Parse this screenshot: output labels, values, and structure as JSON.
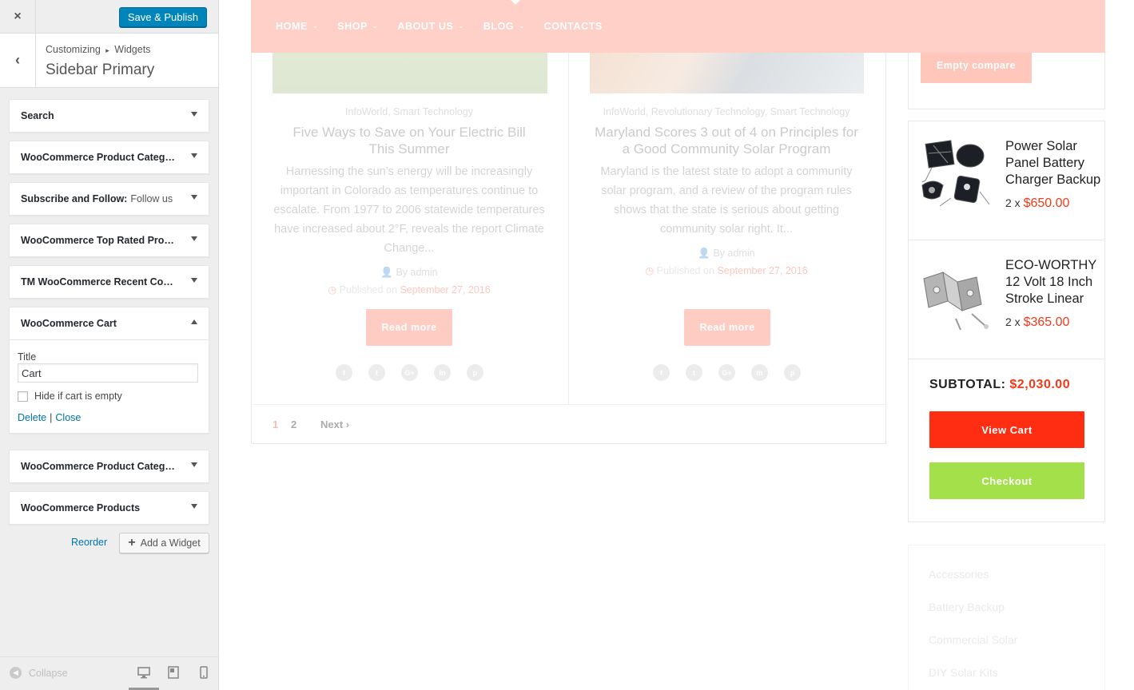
{
  "customizer": {
    "close_label": "×",
    "publish_label": "Save & Publish",
    "back_label": "‹",
    "breadcrumb": {
      "root": "Customizing",
      "sep": "▸",
      "leaf": "Widgets"
    },
    "section_title": "Sidebar Primary",
    "widgets": [
      {
        "name": "Search",
        "sub": ""
      },
      {
        "name": "WooCommerce Product Categor...",
        "sub": ""
      },
      {
        "name": "Subscribe and Follow:",
        "sub": "Follow us"
      },
      {
        "name": "WooCommerce Top Rated Produ...",
        "sub": ""
      },
      {
        "name": "TM WooCommerce Recent Comp...",
        "sub": ""
      },
      {
        "name": "WooCommerce Cart",
        "sub": ""
      },
      {
        "name": "WooCommerce Product Categor...",
        "sub": ""
      },
      {
        "name": "WooCommerce Products",
        "sub": ""
      }
    ],
    "cart_form": {
      "title_label": "Title",
      "title_value": "Cart",
      "hide_label": "Hide if cart is empty",
      "delete_label": "Delete",
      "link_sep": "|",
      "close_label": "Close"
    },
    "reorder_label": "Reorder",
    "add_widget_label": "Add a Widget",
    "collapse_label": "Collapse",
    "icons": [
      "close-icon",
      "back-arrow-icon",
      "chevron-down-icon",
      "chevron-up-icon",
      "plus-icon",
      "collapse-icon",
      "desktop-icon",
      "tablet-icon",
      "mobile-icon"
    ]
  },
  "preview": {
    "nav": [
      "HOME",
      "SHOP",
      "ABOUT US",
      "BLOG",
      "CONTACTS"
    ],
    "posts": [
      {
        "categories": "InfoWorld, Smart Technology",
        "title": "Five Ways to Save on Your Electric Bill This Summer",
        "excerpt": "Harnessing the sun’s energy will be increasingly important in Colorado as temperatures continue to escalate. From 1977 to 2006 statewide temperatures have increased about 2°F, reveals the report Climate Change...",
        "author": "By admin",
        "published": "Published on",
        "date": "September 27, 2016",
        "read_more": "Read more"
      },
      {
        "categories": "InfoWorld, Revolutionary Technology, Smart Technology",
        "title": "Maryland Scores 3 out of 4 on Principles for a Good Community Solar Program",
        "excerpt": "Maryland is the latest state to adopt a community solar program, and a review of the program rules shows that the state is serious about getting community solar right. It...",
        "author": "By admin",
        "published": "Published on",
        "date": "September 27, 2016",
        "read_more": "Read more"
      }
    ],
    "social_icons": [
      "facebook-icon",
      "twitter-icon",
      "google-plus-icon",
      "linkedin-icon",
      "pinterest-icon"
    ],
    "social_glyphs": [
      "f",
      "t",
      "G+",
      "in",
      "p"
    ],
    "pagination": {
      "p1": "1",
      "p2": "2",
      "next": "Next ›"
    },
    "empty_compare": "Empty compare",
    "cart": {
      "items": [
        {
          "name": "Power Solar Panel Battery Charger Backup",
          "qty": "2 x",
          "price": "$650.00"
        },
        {
          "name": "ECO-WORTHY 12 Volt 18 Inch Stroke Linear",
          "qty": "2 x",
          "price": "$365.00"
        }
      ],
      "subtotal_label": "SUBTOTAL:",
      "subtotal_value": "$2,030.00",
      "view_cart": "View Cart",
      "checkout": "Checkout"
    },
    "categories": [
      "Accessories",
      "Battery Backup",
      "Commercial Solar",
      "DIY Solar Kits"
    ],
    "colors": {
      "accent": "#ff3d1a",
      "nav": "#ffd0c7",
      "checkout": "#a4e04a",
      "price": "#f23a1a",
      "wp_blue": "#0085ba"
    }
  }
}
